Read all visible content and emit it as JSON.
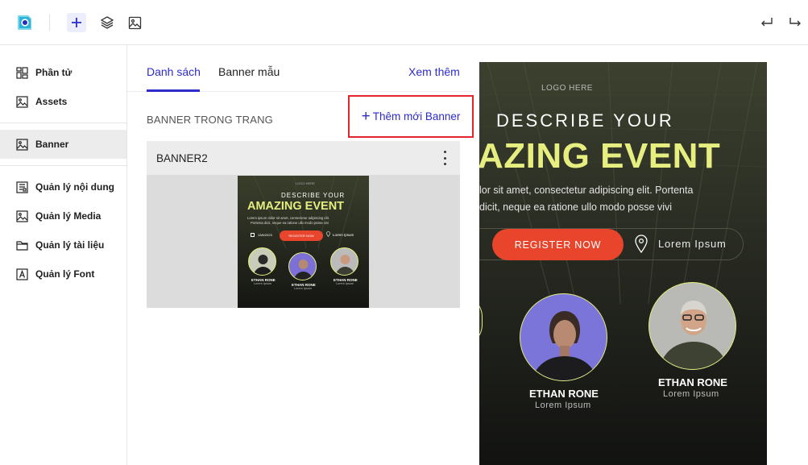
{
  "toolbar": {
    "icons": [
      "app-logo-icon",
      "add-icon",
      "layers-icon",
      "image-icon",
      "undo-icon",
      "redo-icon"
    ]
  },
  "sidebar": {
    "items": [
      {
        "label": "Phần tử",
        "icon": "elements-icon"
      },
      {
        "label": "Assets",
        "icon": "assets-icon"
      },
      {
        "label": "Banner",
        "icon": "banner-icon",
        "active": true
      },
      {
        "label": "Quản lý nội dung",
        "icon": "content-icon"
      },
      {
        "label": "Quản lý Media",
        "icon": "media-icon"
      },
      {
        "label": "Quản lý tài liệu",
        "icon": "folder-icon"
      },
      {
        "label": "Quản lý Font",
        "icon": "font-icon"
      }
    ]
  },
  "panel": {
    "tabs": [
      {
        "label": "Danh sách",
        "active": true
      },
      {
        "label": "Banner mẫu",
        "active": false
      }
    ],
    "more_label": "Xem thêm",
    "section_title": "BANNER TRONG TRANG",
    "add_label": "Thêm mới Banner",
    "card": {
      "title": "BANNER2"
    }
  },
  "banner": {
    "logo": "LOGO HERE",
    "heading": "DESCRIBE YOUR",
    "title": "AMAZING EVENT",
    "title_cropped": "AZING EVENT",
    "body_line1": "lor sit amet, consectetur adipiscing elit. Portenta",
    "body_line2": "dicit, neque ea ratione ullo modo posse vivi",
    "thumb_body_line1": "Lorem ipsum dolor sit amet, consectetur adipiscing elit.",
    "thumb_body_line2": "Portenta dicit, neque ea ratione ullo modo posse vivi",
    "date": "13/6/2023",
    "register_label": "REGISTER NOW",
    "location_label": "Lorem Ipsum",
    "speakers": [
      {
        "name": "ETHAN RONE",
        "role": "Lorem Ipsum"
      },
      {
        "name": "ETHAN RONE",
        "role": "Lorem Ipsum"
      },
      {
        "name": "ETHAN RONE",
        "role": "Lorem Ipsum"
      }
    ]
  },
  "colors": {
    "accent": "#2d2bc9",
    "highlight": "#e3262d",
    "banner_bg": "#1d1f1a",
    "banner_title": "#e6ee7f",
    "register_button": "#e8452c"
  }
}
